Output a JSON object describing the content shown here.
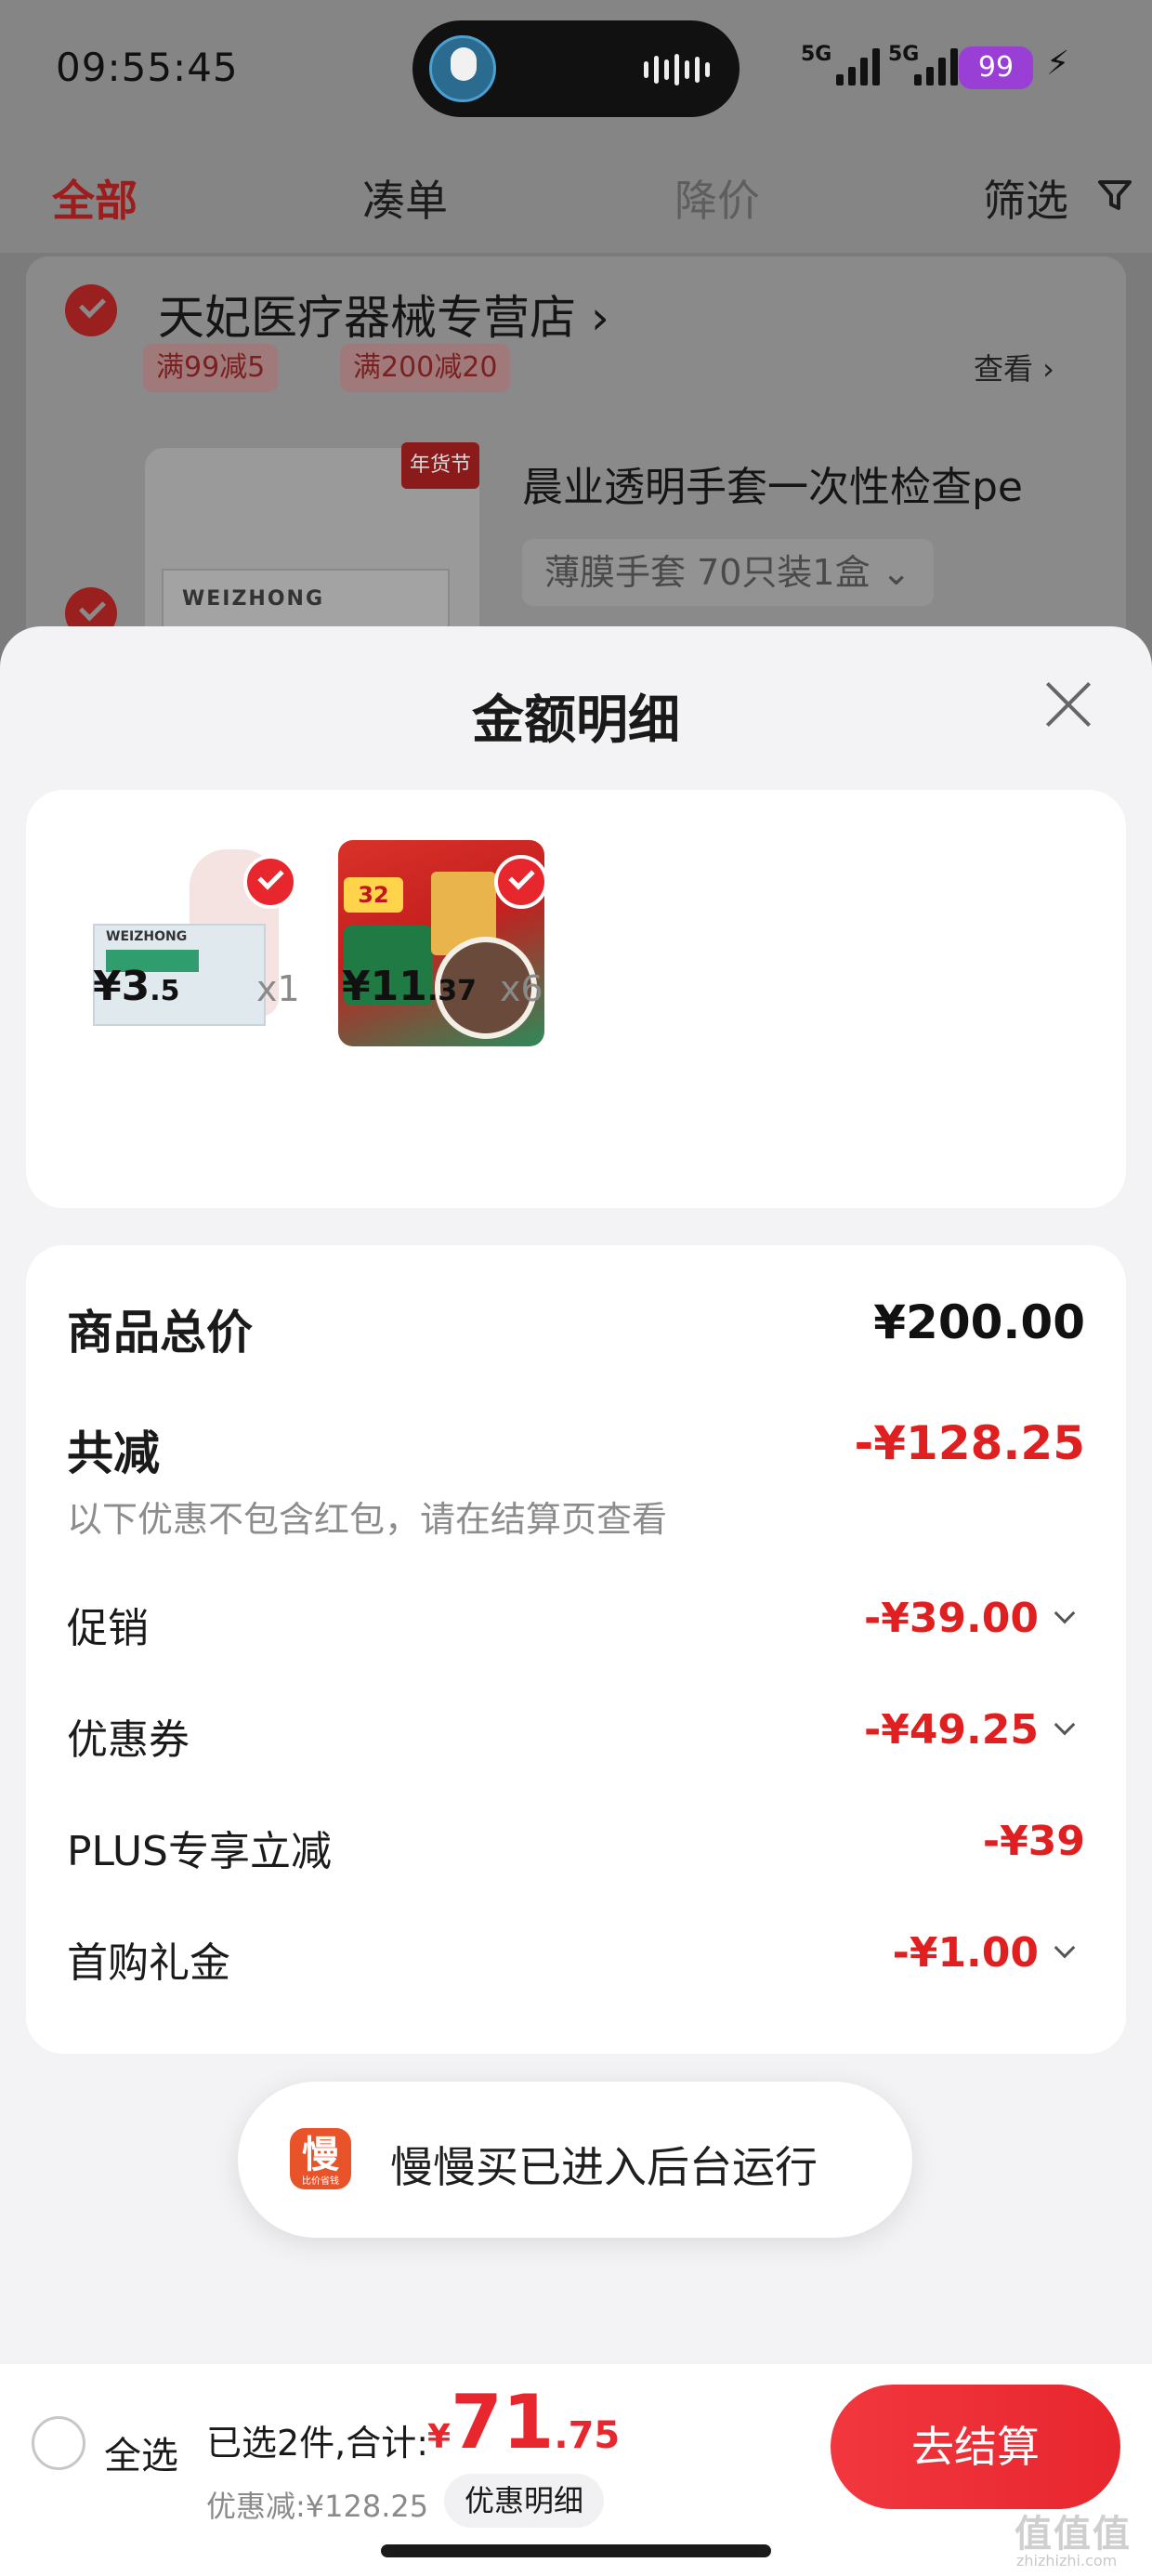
{
  "status_bar": {
    "time": "09:55:45",
    "signal_1": "5G",
    "signal_2": "5G",
    "battery": "99"
  },
  "tabs": {
    "all": "全部",
    "bundle": "凑单",
    "price_drop": "降价",
    "filter": "筛选"
  },
  "store": {
    "name": "天妃医疗器械专营店",
    "name_suffix": "›",
    "promo_1": "满99减5",
    "promo_2": "满200减20",
    "view_more": "查看 ›",
    "product_title": "晨业透明手套一次性检查pe",
    "product_badge": "年货节",
    "product_brand": "WEIZHONG",
    "product_sku": "薄膜手套 70只装1盒 ⌄"
  },
  "sheet": {
    "title": "金额明细",
    "items": [
      {
        "price_int": "¥3",
        "price_dec": ".5",
        "qty": "x1",
        "box_label": "WEIZHONG"
      },
      {
        "price_int": "¥11",
        "price_dec": ".37",
        "qty": "x6",
        "tag": "32"
      }
    ],
    "rows": {
      "goods_total_label": "商品总价",
      "goods_total_value": "¥200.00",
      "total_reduction_label": "共减",
      "total_reduction_value": "-¥128.25",
      "note": "以下优惠不包含红包，请在结算页查看",
      "promotion_label": "促销",
      "promotion_value": "-¥39.00",
      "coupon_label": "优惠券",
      "coupon_value": "-¥49.25",
      "plus_label": "PLUS专享立减",
      "plus_value": "-¥39",
      "first_gift_label": "首购礼金",
      "first_gift_value": "-¥1.00"
    }
  },
  "toast": {
    "icon_char": "慢",
    "icon_sub": "比价省钱",
    "text": "慢慢买已进入后台运行"
  },
  "checkout": {
    "select_all": "全选",
    "selected_prefix": "已选2件,合计:",
    "total_currency": "¥",
    "total_int": "71",
    "total_dec": ".75",
    "discount": "优惠减:¥128.25",
    "detail_button": "优惠明细",
    "checkout_button": "去结算"
  },
  "watermark": {
    "main": "值值值",
    "sub": "zhizhizhi.com"
  },
  "colors": {
    "accent_red": "#e8262e",
    "overlay_gray": "#858585",
    "sheet_bg": "#f3f3f5"
  }
}
